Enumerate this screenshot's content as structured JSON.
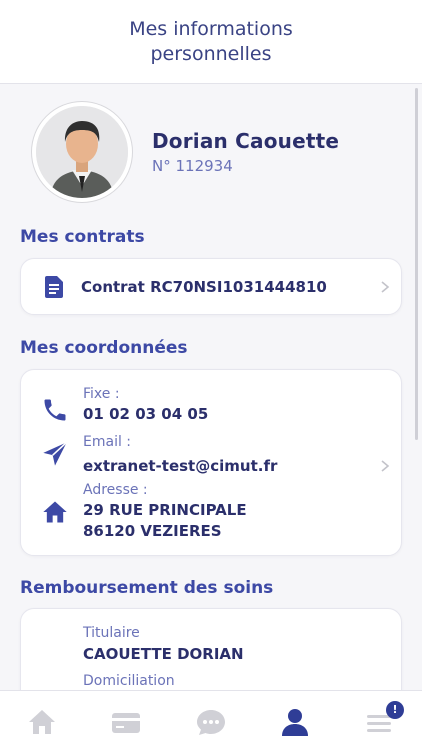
{
  "header": {
    "title": "Mes informations personnelles"
  },
  "profile": {
    "name": "Dorian Caouette",
    "number": "N° 112934"
  },
  "contracts": {
    "title": "Mes contrats",
    "items": [
      {
        "label": "Contrat RC70NSI1031444810"
      }
    ]
  },
  "coordinates": {
    "title": "Mes coordonnées",
    "phone_label": "Fixe :",
    "phone_value": "01 02 03 04 05",
    "email_label": "Email :",
    "email_value": "extranet-test@cimut.fr",
    "address_label": "Adresse :",
    "address_line1": "29 RUE PRINCIPALE",
    "address_line2": "86120 VEZIERES"
  },
  "reimbursement": {
    "title": "Remboursement des soins",
    "holder_label": "Titulaire",
    "holder_value": "CAOUETTE DORIAN",
    "domiciliation_label": "Domiciliation"
  },
  "tabbar": {
    "tabs": [
      {
        "icon": "home-icon"
      },
      {
        "icon": "card-icon"
      },
      {
        "icon": "chat-icon"
      },
      {
        "icon": "profile-icon",
        "active": true
      },
      {
        "icon": "menu-icon"
      }
    ],
    "menu_badge": "!"
  },
  "colors": {
    "accent": "#3d49a5",
    "text": "#2b2f6b",
    "muted": "#6b73b8",
    "inactive": "#d0d0d6"
  }
}
